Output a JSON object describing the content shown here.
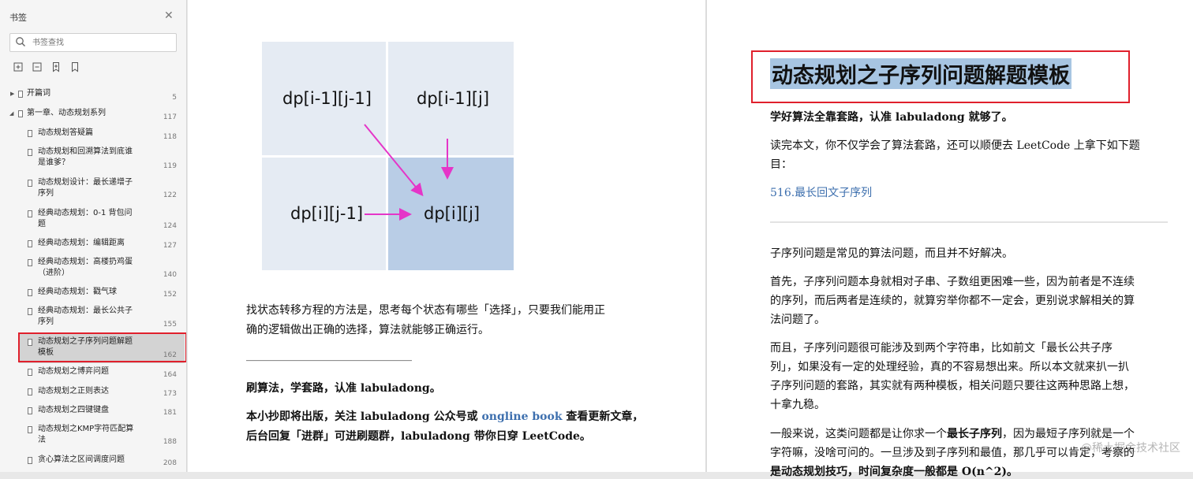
{
  "sidebar": {
    "title": "书签",
    "search_placeholder": "书签查找",
    "items": [
      {
        "label": "开篇词",
        "page": "5"
      },
      {
        "label": "第一章、动态规划系列",
        "page": "117"
      },
      {
        "label": "动态规划答疑篇",
        "page": "118"
      },
      {
        "label": "动态规划和回溯算法到底谁",
        "label2": "是谁爹？",
        "page": "119"
      },
      {
        "label": "动态规划设计：最长递增子",
        "label2": "序列",
        "page": "122"
      },
      {
        "label": "经典动态规划：0-1 背包问",
        "label2": "题",
        "page": "124"
      },
      {
        "label": "经典动态规划：编辑距离",
        "page": "127"
      },
      {
        "label": "经典动态规划：高楼扔鸡蛋",
        "label2": "（进阶）",
        "page": "140"
      },
      {
        "label": "经典动态规划：戳气球",
        "page": "152"
      },
      {
        "label": "经典动态规划：最长公共子",
        "label2": "序列",
        "page": "155"
      },
      {
        "label": "动态规划之子序列问题解题",
        "label2": "模板",
        "page": "162"
      },
      {
        "label": "动态规划之博弈问题",
        "page": "164"
      },
      {
        "label": "动态规划之正则表达",
        "page": "173"
      },
      {
        "label": "动态规划之四键键盘",
        "page": "181"
      },
      {
        "label": "动态规划之KMP字符匹配算",
        "label2": "法",
        "page": "188"
      },
      {
        "label": "贪心算法之区间调度问题",
        "page": "208"
      }
    ]
  },
  "left_page": {
    "diagram": {
      "cells": [
        "dp[i-1][j-1]",
        "dp[i-1][j]",
        "dp[i][j-1]",
        "dp[i][j]"
      ],
      "arrow_color": "#e535c8",
      "highlight_color": "#b9cde6",
      "cell_color": "#e5ebf3"
    },
    "para1_line1": "找状态转移方程的方法是，思考每个状态有哪些「选择」，只要我们能用正",
    "para1_line2": "确的逻辑做出正确的选择，算法就能够正确运行。",
    "separator": "______________________________",
    "slogan": "刷算法，学套路，认准 labuladong。",
    "promo_line1_a": "本小抄即将出版，关注 labuladong 公众号或 ",
    "promo_link": "ongline book",
    "promo_line1_b": " 查看更新文章，",
    "promo_line2": "后台回复「进群」可进刷题群，labuladong 带你日穿 LeetCode。"
  },
  "right_page": {
    "title": "动态规划之子序列问题解题模板",
    "intro_bold": "学好算法全靠套路，认准 labuladong 就够了。",
    "intro_l1": "读完本文，你不仅学会了算法套路，还可以顺便去 LeetCode 上拿下如下题",
    "intro_l2": "目：",
    "problem_link": "516.最长回文子序列",
    "p1": "子序列问题是常见的算法问题，而且并不好解决。",
    "p2_l1": "首先，子序列问题本身就相对子串、子数组更困难一些，因为前者是不连续",
    "p2_l2": "的序列，而后两者是连续的，就算穷举你都不一定会，更别说求解相关的算",
    "p2_l3": "法问题了。",
    "p3_l1": "而且，子序列问题很可能涉及到两个字符串，比如前文「最长公共子序",
    "p3_l2": "列」，如果没有一定的处理经验，真的不容易想出来。所以本文就来扒一扒",
    "p3_l3": "子序列问题的套路，其实就有两种模板，相关问题只要往这两种思路上想，",
    "p3_l4": "十拿九稳。",
    "p4_l1_a": "一般来说，这类问题都是让你求一个",
    "p4_l1_b": "最长子序列",
    "p4_l1_c": "，因为最短子序列就是一个",
    "p4_l2": "字符嘛，没啥可问的。一旦涉及到子序列和最值，那几乎可以肯定，考察的",
    "p4_l3": "是动态规划技巧，时间复杂度一般都是 O(n^2)。",
    "watermark": "@稀土掘金技术社区"
  },
  "colors": {
    "selection_border": "#e0202c",
    "title_highlight": "#a7c5e2",
    "link": "#3d6fae"
  }
}
